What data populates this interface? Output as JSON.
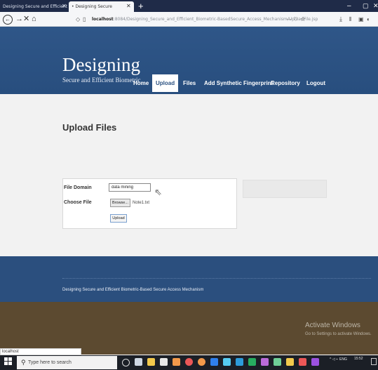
{
  "browser": {
    "tabs": [
      {
        "label": "Designing Secure and Efficient Bio"
      },
      {
        "label": "• Designing Secure"
      }
    ],
    "url_host": "localhost",
    "url_path": ":8084/Designing_Secure_and_Efficient_Biometric-BasedSecure_Access_Mechanism/UploadFile.jsp",
    "tab_close_glyph": "✕",
    "new_tab_glyph": "+",
    "window_controls": {
      "minimize": "–",
      "maximize": "▢",
      "close": "✕"
    }
  },
  "site": {
    "title": "Designing",
    "subtitle": "Secure and Efficient Biometric",
    "menu": [
      "Home",
      "Upload",
      "Files",
      "Add Synthetic Fingerprint",
      "Repository",
      "Logout"
    ],
    "active_menu": "Upload"
  },
  "page": {
    "heading": "Upload Files",
    "form": {
      "domain_label": "File Domain",
      "domain_value": "data mining",
      "file_label": "Choose File",
      "browse_label": "Browse...",
      "file_name": "Note1.txt",
      "upload_label": "Upload"
    }
  },
  "footer": {
    "text": "Designing Secure and Efficient Biometric-Based Secure Access Mechanism"
  },
  "windows": {
    "activate_title": "Activate Windows",
    "activate_sub": "Go to Settings to activate Windows.",
    "status_text": "localhost",
    "search_placeholder": "Type here to search",
    "tray_lang": "ENG",
    "tray_time": "15:52"
  },
  "colors": {
    "header": "#2c5282",
    "footer_top": "#2b4f7e",
    "footer_bottom": "#5c4a30",
    "taskbar": "#1b1f26"
  }
}
